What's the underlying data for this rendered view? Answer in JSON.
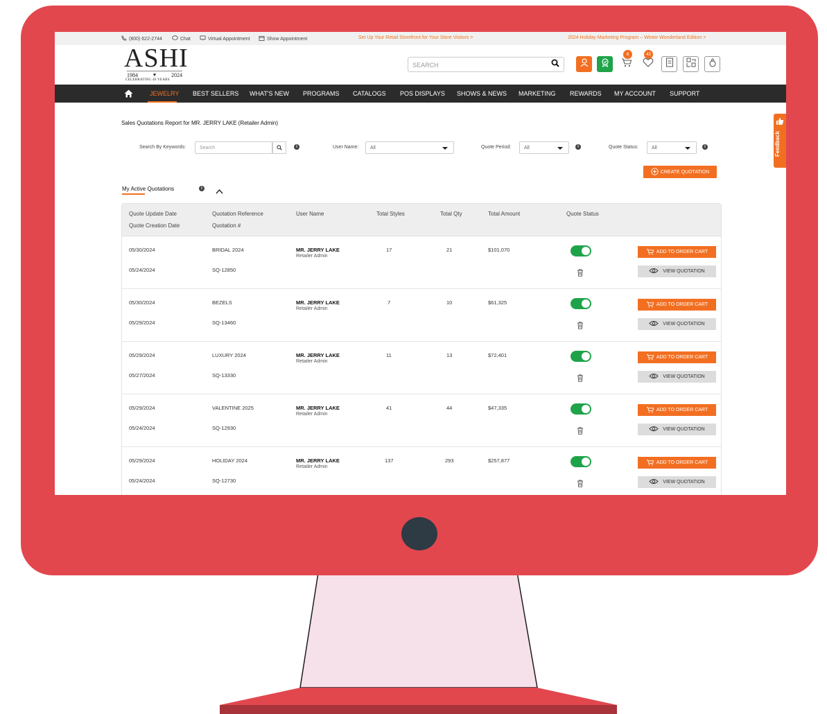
{
  "topbar": {
    "phone": "(800) 622-2744",
    "chat": "Chat",
    "virtual": "Virtual Appointment",
    "show": "Show Appointment",
    "promo_center": "Set Up Your Retail Storefront for Your Store Visitors >",
    "promo_right": "2024 Holiday Marketing Program – Winter Wonderland Edition >"
  },
  "logo": {
    "name": "ASHI",
    "year_start": "1984",
    "year_end": "2024",
    "tagline": "CELEBRATING 40 YEARS"
  },
  "search": {
    "placeholder": "SEARCH"
  },
  "header_icons": {
    "cart_count": "6",
    "wishlist_count": "43"
  },
  "nav": [
    "JEWELRY",
    "BEST SELLERS",
    "WHAT'S NEW",
    "PROGRAMS",
    "CATALOGS",
    "POS DISPLAYS",
    "SHOWS & NEWS",
    "MARKETING",
    "REWARDS",
    "MY ACCOUNT",
    "SUPPORT"
  ],
  "page": {
    "title": "Sales Quotations Report for MR. JERRY LAKE (Retailer Admin)"
  },
  "filters": {
    "keyword_label": "Search By Keywords:",
    "keyword_placeholder": "Search",
    "user_label": "User Name:",
    "user_value": "All",
    "period_label": "Quote Period:",
    "period_value": "All",
    "status_label": "Quote Status:",
    "status_value": "All"
  },
  "create_button": "CREATE QUOTATION",
  "section": {
    "title": "My Active Quotations"
  },
  "table": {
    "headers": {
      "update_date": "Quote Update Date",
      "creation_date": "Quote Creation Date",
      "reference": "Quotation Reference",
      "number": "Quotation #",
      "user": "User Name",
      "styles": "Total Styles",
      "qty": "Total Qty",
      "amount": "Total Amount",
      "status": "Quote Status"
    },
    "rows": [
      {
        "updated": "05/30/2024",
        "created": "05/24/2024",
        "ref": "BRIDAL 2024",
        "num": "SQ-12850",
        "user": "MR. JERRY LAKE",
        "role": "Retailer Admin",
        "styles": "17",
        "qty": "21",
        "amount": "$101,070",
        "active": true
      },
      {
        "updated": "05/30/2024",
        "created": "05/29/2024",
        "ref": "BEZELS",
        "num": "SQ-13460",
        "user": "MR. JERRY LAKE",
        "role": "Retailer Admin",
        "styles": "7",
        "qty": "10",
        "amount": "$61,325",
        "active": true
      },
      {
        "updated": "05/29/2024",
        "created": "05/27/2024",
        "ref": "LUXURY 2024",
        "num": "SQ-13330",
        "user": "MR. JERRY LAKE",
        "role": "Retailer Admin",
        "styles": "11",
        "qty": "13",
        "amount": "$72,401",
        "active": true
      },
      {
        "updated": "05/29/2024",
        "created": "05/24/2024",
        "ref": "VALENTINE 2025",
        "num": "SQ-12930",
        "user": "MR. JERRY LAKE",
        "role": "Retailer Admin",
        "styles": "41",
        "qty": "44",
        "amount": "$47,335",
        "active": true
      },
      {
        "updated": "05/29/2024",
        "created": "05/24/2024",
        "ref": "HOLIDAY 2024",
        "num": "SQ-12730",
        "user": "MR. JERRY LAKE",
        "role": "Retailer Admin",
        "styles": "137",
        "qty": "293",
        "amount": "$257,877",
        "active": true
      }
    ],
    "add_label": "ADD TO ORDER CART",
    "view_label": "VIEW QUOTATION"
  },
  "feedback": "Feedback",
  "colors": {
    "accent": "#f26f22",
    "toggle_on": "#1fa34a",
    "monitor": "#e2474e",
    "nav_bg": "#2b2b2b"
  }
}
